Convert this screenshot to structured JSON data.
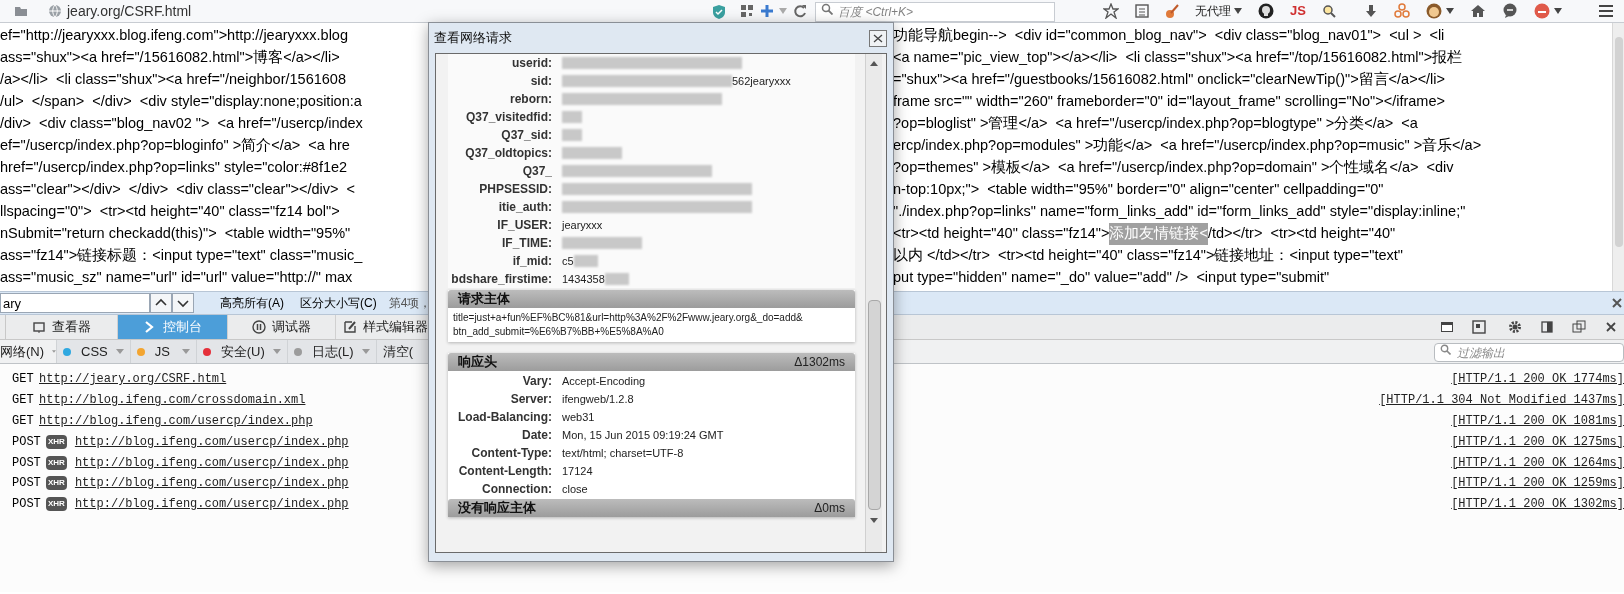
{
  "address_bar": {
    "url": "jeary.org/CSRF.html"
  },
  "search_bar": {
    "placeholder": "百度 <Ctrl+K>"
  },
  "toolbar": {
    "proxy_label": "无代理",
    "js_label": "JS"
  },
  "source_lines": [
    {
      "left": "ef=\"http://jearyxxx.blog.ifeng.com\">http://jearyxxx.blog",
      "right": "功能导航begin-->  <div id=\"common_blog_nav\">  <div class=\"blog_nav01\">  <ul >  <li"
    },
    {
      "left": "ass=\"shux\"><a href=\"/15616082.html\">博客</a></li>",
      "right": "<a name=\"pic_view_top\"></a></li>  <li class=\"shux\"><a href=\"/top/15616082.html\">报栏"
    },
    {
      "left": "/a></li>  <li class=\"shux\"><a href=\"/neighbor/1561608",
      "right": "=\"shux\"><a href=\"/guestbooks/15616082.html\" onclick=\"clearNewTip()\">留言</a></li>"
    },
    {
      "left": "/ul>  </span>  </div>  <div style=\"display:none;position:a",
      "right": "frame src=\"\" width=\"260\" frameborder=\"0\" id=\"layout_frame\" scrolling=\"No\"></iframe>"
    },
    {
      "left": "/div>  <div class=\"blog_nav02 \">  <a href=\"/usercp/index",
      "right": "?op=bloglist\" >管理</a>  <a href=\"/usercp/index.php?op=blogtype\" >分类</a>  <a"
    },
    {
      "left": "ef=\"/usercp/index.php?op=bloginfo\" >简介</a>  <a hre",
      "right": "ercp/index.php?op=modules\" >功能</a>  <a href=\"/usercp/index.php?op=music\" >音乐</a>"
    },
    {
      "left": "href=\"/usercp/index.php?op=links\" style=\"color:#8f1e2",
      "right": "?op=themes\" >模板</a>  <a href=\"/usercp/index.php?op=domain\" >个性域名</a>  <div"
    },
    {
      "left": "ass=\"clear\"></div>  </div>  <div class=\"clear\"></div>  <",
      "right": "n-top:10px;\">  <table width=\"95%\" border=\"0\" align=\"center\" cellpadding=\"0\""
    },
    {
      "left": "llspacing=\"0\">  <tr><td height=\"40\" class=\"fz14 bol\">",
      "right": "\"./index.php?op=links\" name=\"form_links_add\" id=\"form_links_add\" style=\"display:inline;\""
    },
    {
      "left": "nSubmit=\"return checkadd(this)\">  <table width=\"95%\"",
      "right": "<tr><td height=\"40\" class=\"fz14\">",
      "match": "添加友情链接<",
      "after": "/td></tr>  <tr><td height=\"40\""
    },
    {
      "left": "ass=\"fz14\">链接标题：<input type=\"text\" class=\"music_",
      "right": "以内 </td></tr>  <tr><td height=\"40\" class=\"fz14\">链接地址：<input type=\"text\""
    },
    {
      "left": "ass=\"music_sz\" name=\"url\" id=\"url\" value=\"http://\" max",
      "right": "put type=\"hidden\" name=\"_do\" value=\"add\" />  <input type=\"submit\""
    }
  ],
  "find_bar": {
    "value": "ary",
    "highlight_all": "高亮所有(A)",
    "match_case": "区分大小写(C)",
    "status": "第4项，"
  },
  "devtools": {
    "tabs": [
      {
        "label": "查看器",
        "selected": false
      },
      {
        "label": "控制台",
        "selected": true
      },
      {
        "label": "调试器",
        "selected": false
      },
      {
        "label": "样式编辑器",
        "selected": false
      }
    ],
    "filters": [
      {
        "kind": "menu",
        "label": "网络(N)"
      },
      {
        "kind": "menu",
        "label": "CSS",
        "color": "#2fa8e0"
      },
      {
        "kind": "menu",
        "label": "JS",
        "color": "#f3a530"
      },
      {
        "kind": "menu",
        "label": "安全(U)",
        "color": "#e5303a"
      },
      {
        "kind": "menu",
        "label": "日志(L)",
        "color": "#9c9c9c"
      },
      {
        "kind": "button",
        "label": "清空("
      }
    ],
    "filter_placeholder": "过滤输出",
    "requests": [
      {
        "method": "GET",
        "url": "http://jeary.org/CSRF.html",
        "status": "[HTTP/1.1 200 OK 1774ms]"
      },
      {
        "method": "GET",
        "url": "http://blog.ifeng.com/crossdomain.xml",
        "status": "[HTTP/1.1 304 Not Modified 1437ms]"
      },
      {
        "method": "GET",
        "url": "http://blog.ifeng.com/usercp/index.php",
        "status": "[HTTP/1.1 200 OK 1081ms]"
      },
      {
        "method": "POST",
        "badge": "XHR",
        "url": "http://blog.ifeng.com/usercp/index.php",
        "status": "[HTTP/1.1 200 OK 1275ms]"
      },
      {
        "method": "POST",
        "badge": "XHR",
        "url": "http://blog.ifeng.com/usercp/index.php",
        "status": "[HTTP/1.1 200 OK 1264ms]"
      },
      {
        "method": "POST",
        "badge": "XHR",
        "url": "http://blog.ifeng.com/usercp/index.php",
        "status": "[HTTP/1.1 200 OK 1259ms]"
      },
      {
        "method": "POST",
        "badge": "XHR",
        "url": "http://blog.ifeng.com/usercp/index.php",
        "status": "[HTTP/1.1 200 OK 1302ms]"
      }
    ]
  },
  "dialog": {
    "title": "查看网络请求",
    "cookies": [
      {
        "kind": "hidden",
        "label": "userid:"
      },
      {
        "kind": "prefix",
        "label": "sid:",
        "value": "562jearyxxx"
      },
      {
        "kind": "hidden",
        "label": "reborn:"
      },
      {
        "kind": "hidden",
        "label": "Q37_visitedfid:"
      },
      {
        "kind": "hidden",
        "label": "Q37_sid:"
      },
      {
        "kind": "hidden",
        "label": "Q37_oldtopics:"
      },
      {
        "kind": "hidden",
        "label": "Q37_"
      },
      {
        "kind": "hidden",
        "label": "PHPSESSID:"
      },
      {
        "kind": "hidden",
        "label": "itie_auth:"
      },
      {
        "kind": "plain",
        "label": "IF_USER:",
        "value": "jearyxxx"
      },
      {
        "kind": "hidden",
        "label": "IF_TIME:"
      },
      {
        "kind": "suffix",
        "label": "if_mid:",
        "value": "c5"
      },
      {
        "kind": "suffix",
        "label": "bdshare_firstime:",
        "value": "1434358"
      }
    ],
    "request_body": {
      "title": "请求主体",
      "lines": [
        "title=just+a+fun%EF%BC%81&url=http%3A%2F%2Fwww.jeary.org&_do=add&",
        "btn_add_submit=%E6%B7%BB+%E5%8A%A0"
      ]
    },
    "response_headers": {
      "title": "响应头",
      "delta": "Δ1302ms",
      "rows": [
        {
          "label": "Vary:",
          "value": "Accept-Encoding"
        },
        {
          "label": "Server:",
          "value": "ifengweb/1.2.8"
        },
        {
          "label": "Load-Balancing:",
          "value": "web31"
        },
        {
          "label": "Date:",
          "value": "Mon, 15 Jun 2015 09:19:24 GMT"
        },
        {
          "label": "Content-Type:",
          "value": "text/html; charset=UTF-8"
        },
        {
          "label": "Content-Length:",
          "value": "17124"
        },
        {
          "label": "Connection:",
          "value": "close"
        }
      ]
    },
    "response_body": {
      "title": "没有响应主体",
      "delta": "Δ0ms"
    }
  }
}
